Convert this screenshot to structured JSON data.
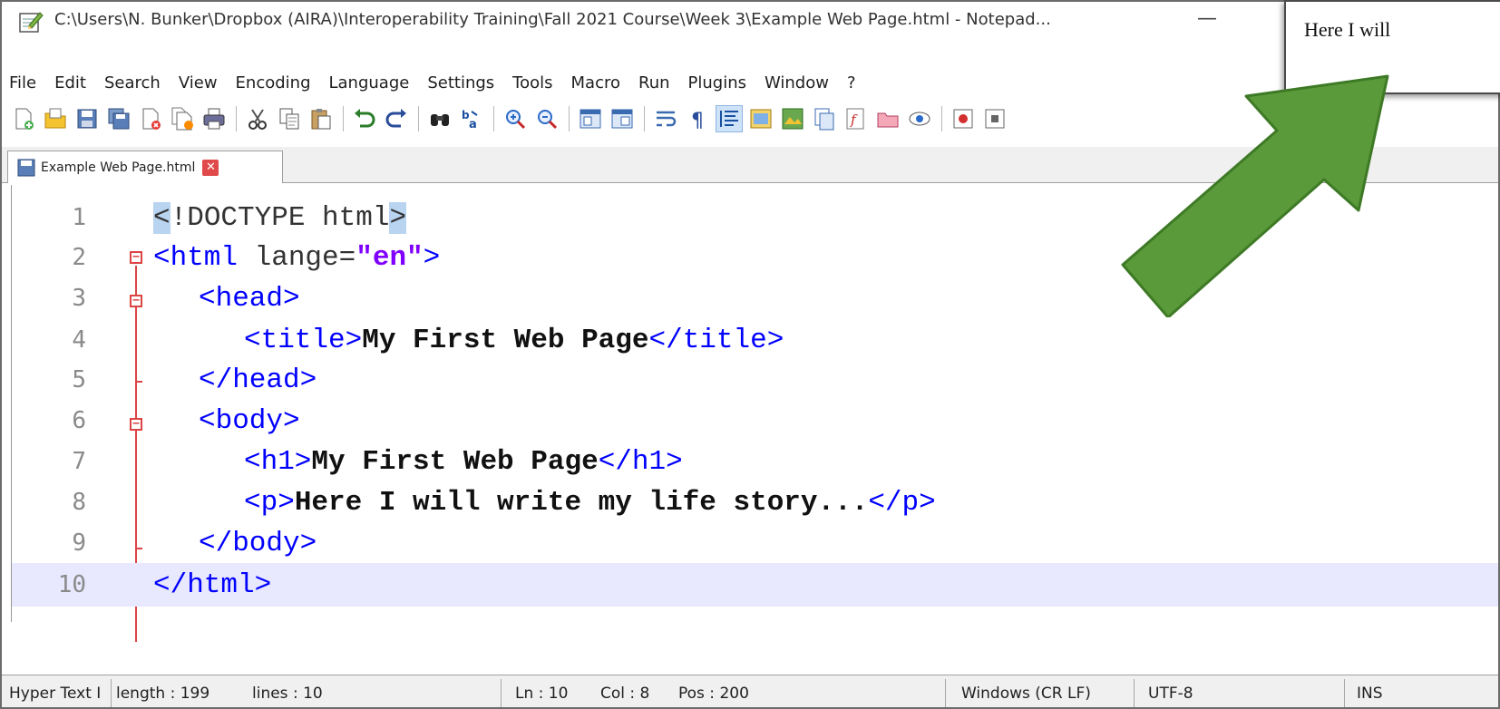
{
  "window": {
    "title": "C:\\Users\\N. Bunker\\Dropbox (AIRA)\\Interoperability Training\\Fall 2021 Course\\Week 3\\Example Web Page.html - Notepad...",
    "minimize_label": "—"
  },
  "menu": [
    "File",
    "Edit",
    "Search",
    "View",
    "Encoding",
    "Language",
    "Settings",
    "Tools",
    "Macro",
    "Run",
    "Plugins",
    "Window",
    "?"
  ],
  "toolbar": {
    "buttons": [
      "new-file",
      "open-file",
      "save",
      "save-all",
      "close",
      "close-all",
      "print",
      "cut",
      "copy",
      "paste",
      "undo",
      "redo",
      "find",
      "replace",
      "zoom-in",
      "zoom-out",
      "sync-vertical",
      "sync-horizontal",
      "word-wrap",
      "show-all-characters",
      "indent-guide",
      "user-defined-language",
      "document-map",
      "function-list",
      "folder-as-workspace",
      "monitoring",
      "record-macro",
      "stop-recording"
    ]
  },
  "tab": {
    "label": "Example Web Page.html",
    "close_label": "✕"
  },
  "editor": {
    "current_line": 10,
    "lines": [
      {
        "num": "1",
        "lt": "<",
        "bang": "!",
        "doctype": "DOCTYPE html",
        "gt": ">"
      },
      {
        "num": "2",
        "open": "<html ",
        "attr": "lange=",
        "value": "\"en\"",
        "close": ">"
      },
      {
        "num": "3",
        "tag": "<head>"
      },
      {
        "num": "4",
        "open": "<title>",
        "text": "My First Web Page",
        "close": "</title>"
      },
      {
        "num": "5",
        "tag": "</head>"
      },
      {
        "num": "6",
        "tag": "<body>"
      },
      {
        "num": "7",
        "open": "<h1>",
        "text": "My First Web Page",
        "close": "</h1>"
      },
      {
        "num": "8",
        "open": "<p>",
        "text": "Here I will write my life story...",
        "close": "</p>"
      },
      {
        "num": "9",
        "tag": "</body>"
      },
      {
        "num": "10",
        "tag": "</html>"
      }
    ]
  },
  "status": {
    "language": "Hyper Text I",
    "length": "length : 199",
    "lines": "lines : 10",
    "ln": "Ln : 10",
    "col": "Col : 8",
    "pos": "Pos : 200",
    "eol": "Windows (CR LF)",
    "encoding": "UTF-8",
    "mode": "INS"
  },
  "preview": {
    "text": "Here I will"
  },
  "colors": {
    "tag": "#0000ff",
    "string": "#8000ff",
    "current_line_bg": "#e8e8ff",
    "fold": "#dd4444",
    "arrow": "#5b9a3a"
  }
}
